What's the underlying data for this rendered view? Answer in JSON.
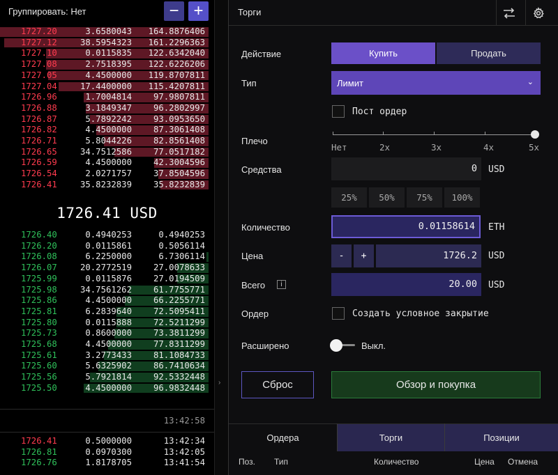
{
  "book": {
    "group_label": "Группировать: Нет",
    "zoom_out": "−",
    "zoom_in": "+",
    "asks": [
      {
        "price": "1727.20",
        "qty": "3.6580043",
        "total": "164.8876406",
        "depth": 1.0
      },
      {
        "price": "1727.12",
        "qty": "38.5954323",
        "total": "161.2296363",
        "depth": 0.98
      },
      {
        "price": "1727.10",
        "qty": "0.0115835",
        "total": "122.6342040",
        "depth": 0.78
      },
      {
        "price": "1727.08",
        "qty": "2.7518395",
        "total": "122.6226206",
        "depth": 0.78
      },
      {
        "price": "1727.05",
        "qty": "4.4500000",
        "total": "119.8707811",
        "depth": 0.77
      },
      {
        "price": "1727.04",
        "qty": "17.4400000",
        "total": "115.4207811",
        "depth": 0.72
      },
      {
        "price": "1726.96",
        "qty": "1.7004814",
        "total": "97.9807811",
        "depth": 0.6
      },
      {
        "price": "1726.88",
        "qty": "3.1849347",
        "total": "96.2802997",
        "depth": 0.59
      },
      {
        "price": "1726.87",
        "qty": "5.7892242",
        "total": "93.0953650",
        "depth": 0.57
      },
      {
        "price": "1726.82",
        "qty": "4.4500000",
        "total": "87.3061408",
        "depth": 0.54
      },
      {
        "price": "1726.71",
        "qty": "5.8044226",
        "total": "82.8561408",
        "depth": 0.5
      },
      {
        "price": "1726.65",
        "qty": "34.7512586",
        "total": "77.0517182",
        "depth": 0.45
      },
      {
        "price": "1726.59",
        "qty": "4.4500000",
        "total": "42.3004596",
        "depth": 0.26
      },
      {
        "price": "1726.54",
        "qty": "2.0271757",
        "total": "37.8504596",
        "depth": 0.24
      },
      {
        "price": "1726.41",
        "qty": "35.8232839",
        "total": "35.8232839",
        "depth": 0.23
      }
    ],
    "mid_price": "1726.41 USD",
    "bids": [
      {
        "price": "1726.40",
        "qty": "0.4940253",
        "total": "0.4940253",
        "depth": 0.0
      },
      {
        "price": "1726.20",
        "qty": "0.0115861",
        "total": "0.5056114",
        "depth": 0.0
      },
      {
        "price": "1726.08",
        "qty": "6.2250000",
        "total": "6.7306114",
        "depth": 0.01
      },
      {
        "price": "1726.07",
        "qty": "20.2772519",
        "total": "27.0078633",
        "depth": 0.15
      },
      {
        "price": "1725.99",
        "qty": "0.0115876",
        "total": "27.0194509",
        "depth": 0.15
      },
      {
        "price": "1725.98",
        "qty": "34.7561262",
        "total": "61.7755771",
        "depth": 0.38
      },
      {
        "price": "1725.86",
        "qty": "4.4500000",
        "total": "66.2255771",
        "depth": 0.4
      },
      {
        "price": "1725.81",
        "qty": "6.2839640",
        "total": "72.5095411",
        "depth": 0.44
      },
      {
        "price": "1725.80",
        "qty": "0.0115888",
        "total": "72.5211299",
        "depth": 0.44
      },
      {
        "price": "1725.73",
        "qty": "0.8600000",
        "total": "73.3811299",
        "depth": 0.45
      },
      {
        "price": "1725.68",
        "qty": "4.4500000",
        "total": "77.8311299",
        "depth": 0.48
      },
      {
        "price": "1725.61",
        "qty": "3.2773433",
        "total": "81.1084733",
        "depth": 0.5
      },
      {
        "price": "1725.60",
        "qty": "5.6325902",
        "total": "86.7410634",
        "depth": 0.53
      },
      {
        "price": "1725.56",
        "qty": "5.7921814",
        "total": "92.5332448",
        "depth": 0.57
      },
      {
        "price": "1725.50",
        "qty": "4.4500000",
        "total": "96.9832448",
        "depth": 0.6
      }
    ],
    "book_time": "13:42:58",
    "trades": [
      {
        "side": "sell",
        "price": "1726.41",
        "qty": "0.5000000",
        "time": "13:42:34"
      },
      {
        "side": "buy",
        "price": "1726.81",
        "qty": "0.0970300",
        "time": "13:42:05"
      },
      {
        "side": "buy",
        "price": "1726.76",
        "qty": "1.8178705",
        "time": "13:41:54"
      }
    ]
  },
  "panel": {
    "title": "Торги",
    "labels": {
      "action": "Действие",
      "type": "Тип",
      "leverage": "Плечо",
      "funds": "Средства",
      "quantity": "Количество",
      "price": "Цена",
      "total": "Всего",
      "order": "Ордер",
      "advanced": "Расширено"
    },
    "buy_label": "Купить",
    "sell_label": "Продать",
    "type_value": "Лимит",
    "post_order_label": "Пост ордер",
    "leverage_ticks": [
      "Нет",
      "2x",
      "3x",
      "4x",
      "5x"
    ],
    "leverage_value": 1.0,
    "funds_value": "0",
    "funds_unit": "USD",
    "pct_buttons": [
      "25%",
      "50%",
      "75%",
      "100%"
    ],
    "quantity_value": "0.01158614",
    "quantity_unit": "ETH",
    "price_minus": "-",
    "price_plus": "+",
    "price_value": "1726.2",
    "price_unit": "USD",
    "info_icon": "i",
    "total_value": "20.00",
    "total_unit": "USD",
    "conditional_close_label": "Создать условное закрытие",
    "advanced_toggle_label": "Выкл.",
    "reset_label": "Сброс",
    "review_label": "Обзор и покупка",
    "tabs": [
      "Ордера",
      "Торги",
      "Позиции"
    ],
    "columns": [
      "Поз.",
      "Тип",
      "Количество",
      "Цена",
      "Отмена"
    ]
  }
}
